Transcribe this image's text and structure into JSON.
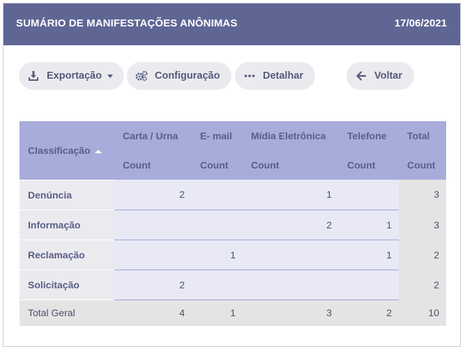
{
  "header": {
    "title": "SUMÁRIO DE MANIFESTAÇÕES ANÔNIMAS",
    "date": "17/06/2021"
  },
  "toolbar": {
    "export_label": "Exportação",
    "config_label": "Configuração",
    "detail_label": "Detalhar",
    "back_label": "Voltar"
  },
  "table": {
    "row_header": "Classificação",
    "columns": [
      "Carta / Urna",
      "E- mail",
      "Mídia Eletrônica",
      "Telefone",
      "Total"
    ],
    "measure": "Count",
    "rows": [
      {
        "label": "Denúncia",
        "values": [
          "2",
          "",
          "1",
          "",
          "3"
        ]
      },
      {
        "label": "Informação",
        "values": [
          "",
          "",
          "2",
          "1",
          "3"
        ]
      },
      {
        "label": "Reclamação",
        "values": [
          "",
          "1",
          "",
          "1",
          "2"
        ]
      },
      {
        "label": "Solicitação",
        "values": [
          "2",
          "",
          "",
          "",
          "2"
        ]
      }
    ],
    "grand_total": {
      "label": "Total Geral",
      "values": [
        "4",
        "1",
        "3",
        "2",
        "10"
      ]
    }
  },
  "colors": {
    "header_bg": "#5f6694",
    "table_header_bg": "#a8acda",
    "button_bg": "#ebebef"
  }
}
